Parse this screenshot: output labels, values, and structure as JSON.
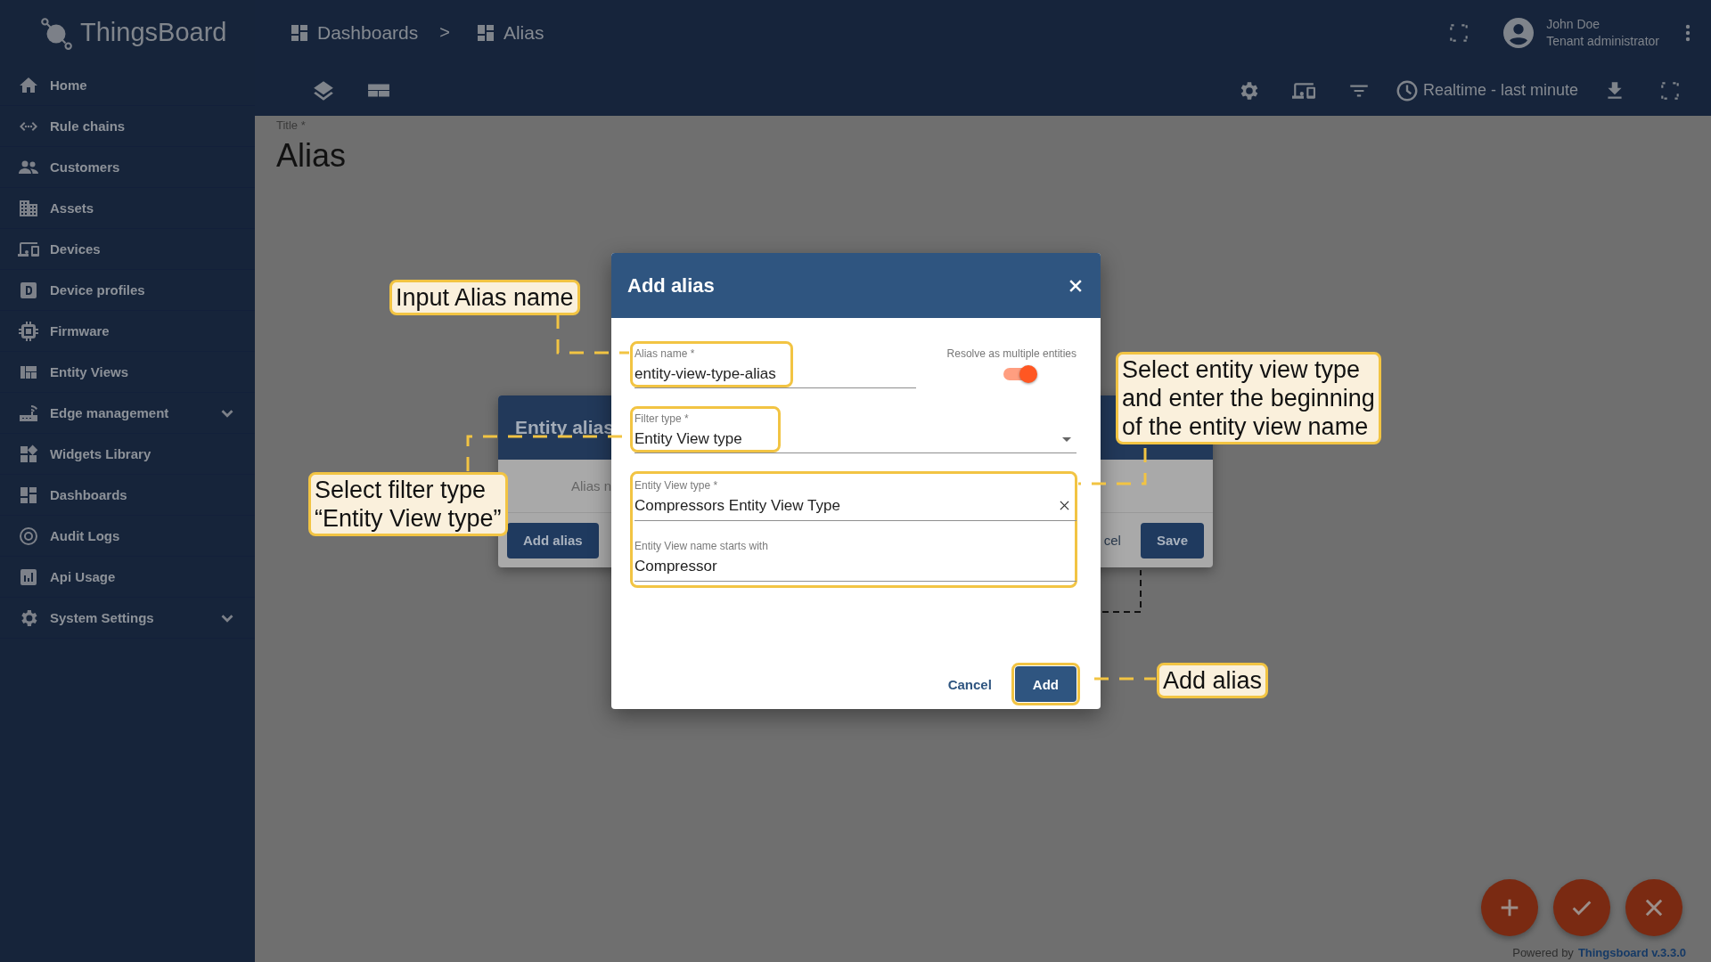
{
  "logo": {
    "text": "ThingsBoard"
  },
  "sidebar": {
    "items": [
      {
        "label": "Home",
        "expandable": false
      },
      {
        "label": "Rule chains",
        "expandable": false
      },
      {
        "label": "Customers",
        "expandable": false
      },
      {
        "label": "Assets",
        "expandable": false
      },
      {
        "label": "Devices",
        "expandable": false
      },
      {
        "label": "Device profiles",
        "expandable": false
      },
      {
        "label": "Firmware",
        "expandable": false
      },
      {
        "label": "Entity Views",
        "expandable": false
      },
      {
        "label": "Edge management",
        "expandable": true
      },
      {
        "label": "Widgets Library",
        "expandable": false
      },
      {
        "label": "Dashboards",
        "expandable": false
      },
      {
        "label": "Audit Logs",
        "expandable": false
      },
      {
        "label": "Api Usage",
        "expandable": false
      },
      {
        "label": "System Settings",
        "expandable": true
      }
    ]
  },
  "breadcrumbs": {
    "items": [
      {
        "label": "Dashboards"
      },
      {
        "label": "Alias"
      }
    ],
    "separator": ">"
  },
  "user": {
    "name": "John Doe",
    "role": "Tenant administrator"
  },
  "toolbar": {
    "timewindow": "Realtime - last minute"
  },
  "dashboard": {
    "title_label": "Title *",
    "title": "Alias"
  },
  "background_dialog": {
    "title": "Entity alias",
    "column_1": "Alias n",
    "buttons": [
      {
        "kind": "primary",
        "label": "Add alias"
      },
      {
        "kind": "text",
        "label": "cel"
      },
      {
        "kind": "primary",
        "label": "Save"
      }
    ]
  },
  "dialog": {
    "title": "Add alias",
    "fields": [
      {
        "kind": "text",
        "label": "Alias name *",
        "value": "entity-view-type-alias"
      },
      {
        "kind": "select",
        "label": "Filter type *",
        "value": "Entity View type"
      },
      {
        "kind": "autocomplete",
        "label": "Entity View type *",
        "value": "Compressors Entity View Type"
      },
      {
        "kind": "text",
        "label": "Entity View name starts with",
        "value": "Compressor"
      }
    ],
    "toggle": {
      "label": "Resolve as multiple entities",
      "on": true
    },
    "buttons": [
      {
        "kind": "text",
        "label": "Cancel"
      },
      {
        "kind": "primary",
        "label": "Add"
      }
    ]
  },
  "callouts": [
    {
      "text": "Input Alias name"
    },
    {
      "text": "Select filter type\n“Entity View type”"
    },
    {
      "text": "Select entity view type\nand enter the beginning\nof the entity view name"
    },
    {
      "text": "Add alias"
    }
  ],
  "footer": {
    "powered_by": "Powered by",
    "version_link": "Thingsboard v.3.3.0"
  }
}
